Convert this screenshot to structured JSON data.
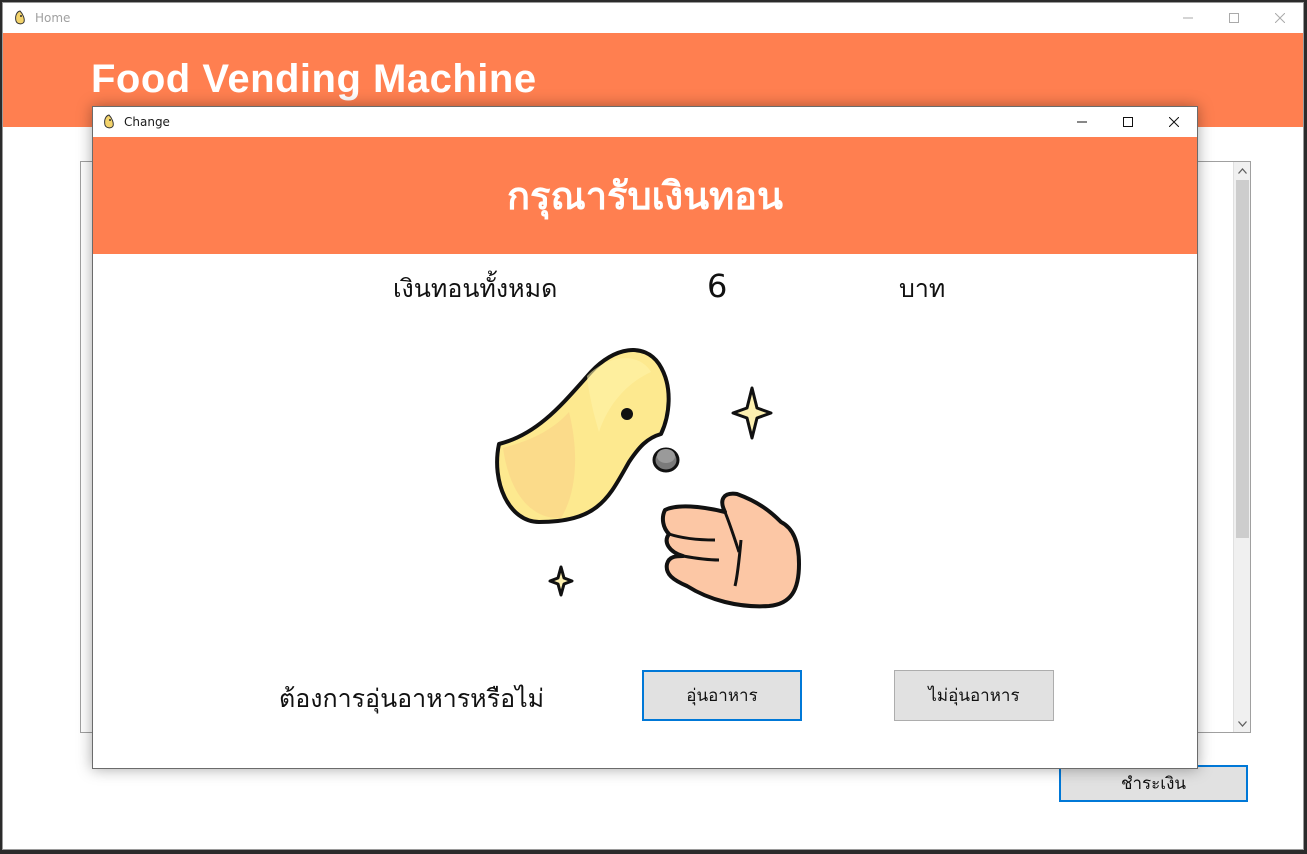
{
  "home": {
    "window_title": "Home",
    "header_title": "Food Vending Machine",
    "pay_button": "ชำระเงิน"
  },
  "dialog": {
    "window_title": "Change",
    "heading": "กรุณารับเงินทอน",
    "total_label": "เงินทอนทั้งหมด",
    "total_amount": "6",
    "currency": "บาท",
    "question": "ต้องการอุ่นอาหารหรือไม่",
    "heat_button": "อุ่นอาหาร",
    "no_heat_button": "ไม่อุ่นอาหาร"
  },
  "colors": {
    "header": "#ff7f50",
    "focus_border": "#0078d7",
    "button_bg": "#e1e1e1"
  },
  "icons": [
    "app-icon",
    "minimize-icon",
    "maximize-icon",
    "close-icon",
    "scroll-up-icon",
    "scroll-down-icon",
    "coin-illustration"
  ]
}
